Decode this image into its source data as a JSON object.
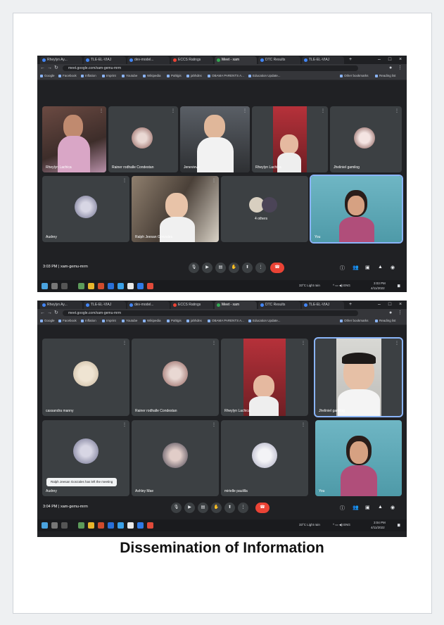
{
  "caption": "Dissemination of Information",
  "screens": [
    {
      "tabs": [
        "Rheylyn Ay...",
        "TLE-EL-VIAJ",
        "dev-model...",
        "ECCS Ratings",
        "Meet - xam",
        "DTC Results",
        "TLE-EL-VIAJ"
      ],
      "url": "meet.google.com/xam-gemu-mrm",
      "bookmarks": [
        "Google",
        "Facebook",
        "Inflation",
        "Imprint",
        "Youtube",
        "Wikipedia",
        "Pahlgis",
        "jahhdns",
        "OBAMA PARENTS A...",
        "Education Update..."
      ],
      "bookmarks_right": [
        "Other bookmarks",
        "Reading list"
      ],
      "participants": [
        {
          "name": "Rheylyn Lachica",
          "kind": "video"
        },
        {
          "name": "Rainer rodhalle Condestan",
          "kind": "avatar"
        },
        {
          "name": "Jenevieve",
          "kind": "video"
        },
        {
          "name": "Rheylyn Lachica",
          "kind": "video"
        },
        {
          "name": "Jheliniel gamilog",
          "kind": "avatar"
        },
        {
          "name": "Audrey",
          "kind": "avatar"
        },
        {
          "name": "Ralph Jeesan Gonzales",
          "kind": "video"
        },
        {
          "name": "4 others",
          "kind": "group"
        },
        {
          "name": "You",
          "kind": "video"
        }
      ],
      "time": "3:03 PM",
      "meeting_code": "xam-gemu-mrm",
      "taskbar_weather": "33°C Light rain",
      "taskbar_time": "3:03 PM",
      "taskbar_date": "4/11/2022"
    },
    {
      "tabs": [
        "Rheylyn Ay...",
        "TLE-EL-VIAJ",
        "dev-model...",
        "ECCS Ratings",
        "Meet - xam",
        "DTC Results",
        "TLE-EL-VIAJ"
      ],
      "url": "meet.google.com/xam-gemu-mrm",
      "bookmarks": [
        "Google",
        "Facebook",
        "Inflation",
        "Imprint",
        "Youtube",
        "Wikipedia",
        "Pahlgis",
        "jahhdns",
        "OBAMA PARENTS A...",
        "Education Update..."
      ],
      "bookmarks_right": [
        "Other bookmarks",
        "Reading list"
      ],
      "participants": [
        {
          "name": "cassandra manny",
          "kind": "avatar"
        },
        {
          "name": "Rainer rodhalle Condestan",
          "kind": "avatar"
        },
        {
          "name": "Rheylyn Lachica",
          "kind": "video"
        },
        {
          "name": "Jheliniel gamilog",
          "kind": "video"
        },
        {
          "name": "Audrey",
          "kind": "avatar"
        },
        {
          "name": "Ashley Mae",
          "kind": "avatar"
        },
        {
          "name": "mirielle paulilla",
          "kind": "avatar"
        },
        {
          "name": "You",
          "kind": "video"
        }
      ],
      "toast": "Ralph Jeesan Gonzales has left the meeting",
      "time": "3:04 PM",
      "meeting_code": "xam-gemu-mrm",
      "taskbar_weather": "33°C Light rain",
      "taskbar_time": "3:04 PM",
      "taskbar_date": "4/11/2022"
    }
  ],
  "icons": [
    "mic-icon",
    "camera-icon",
    "captions-icon",
    "raise-hand-icon",
    "present-icon",
    "more-options-icon",
    "end-call-icon",
    "info-icon",
    "people-icon",
    "chat-icon",
    "activities-icon",
    "lock-icon"
  ],
  "colors": {
    "meet_bg": "#202124",
    "tile": "#3c4043",
    "end_call": "#ea4335",
    "active_border": "#8ab4f8"
  }
}
